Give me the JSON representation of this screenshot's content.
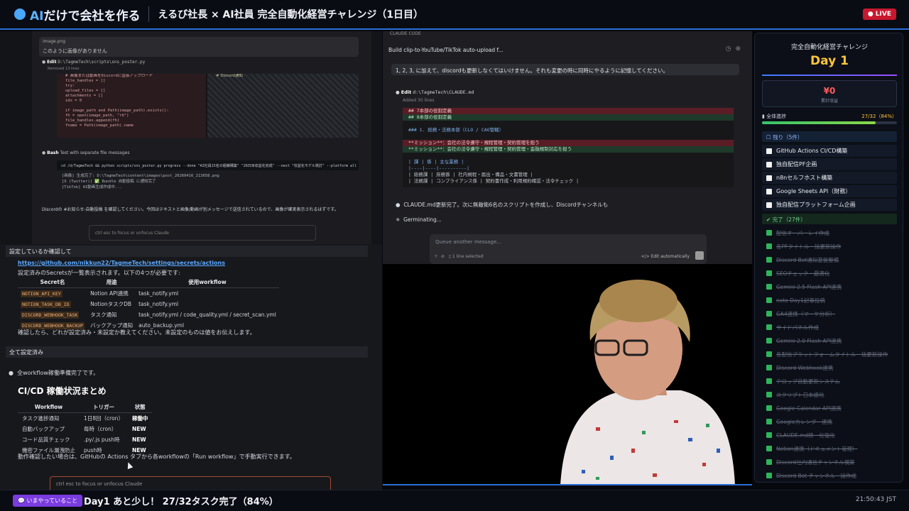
{
  "header": {
    "logo_prefix": "AI",
    "logo_suffix": "だけで会社を作る",
    "stream_title": "えるび社長 × AI社員 完全自動化経営チャレンジ（1日目）",
    "live_label": "● LIVE"
  },
  "left_top": {
    "image_card_name": "image.png",
    "image_card_text": "このように画像がありません",
    "edit_label": "Edit",
    "edit_path": "D:\\TagmeTech\\scripts\\sns_poster.py",
    "edit_meta": "Removed 13 lines",
    "diff_lines": [
      "# 画像または動画をDiscordに直接アップロード",
      "file_handles = []",
      "try:",
      "    upload_files = []",
      "    attachments = []",
      "    idx = 0",
      "",
      "    if image_path and Path(image_path).exists():",
      "        fh = open(image_path, \"rb\")",
      "        file_handles.append(fh)",
      "        fname = Path(image_path).name"
    ],
    "diff_right": "# Discord通知",
    "bash_label": "Bash",
    "bash_desc": "Test with separate file messages",
    "bash_cmd": "cd /d/TagmeTech && python scripts/sns_poster.py progress --done \"AI社員15名の組織構築\" \"26日目収益化完成\" --next \"収益化モデル検討\" --platform all 2>&1",
    "output_lines": [
      "[画像] 生成完了: D:\\TagmeTech\\content\\images\\post_20260416_213658.png",
      "[X (Twitter)] ✅ Bundle 自動投稿 に通知完了",
      "[TikTok] AI動画生成作成中..."
    ],
    "discord_note": "Discordの #お知らせ-自動投稿 を確認してください。今回はテキストと画像/動画が別メッセージで送信されているので、画像が確実表示されるはずです。",
    "input_hint": "ctrl esc to focus or unfocus Claude"
  },
  "left_bottom": {
    "confirm_heading": "設定しているか確認して",
    "link": "https://github.com/nikkun22/TagmeTech/settings/secrets/actions",
    "intro": "設定済みのSecretsが一覧表示されます。以下の4つが必要です:",
    "secret_headers": [
      "Secret名",
      "用途",
      "使用workflow"
    ],
    "secrets": [
      [
        "NOTION_API_KEY",
        "Notion API連携",
        "task_notify.yml"
      ],
      [
        "NOTION_TASK_DB_ID",
        "NotionタスクDB",
        "task_notify.yml"
      ],
      [
        "DISCORD_WEBHOOK_TASK",
        "タスク通知",
        "task_notify.yml / code_quality.yml / secret_scan.yml"
      ],
      [
        "DISCORD_WEBHOOK_BACKUP",
        "バックアップ通知",
        "auto_backup.yml"
      ]
    ],
    "confirm_after": "確認したら、どれが設定済み・未設定か教えてください。未設定のものは値をお伝えします。",
    "all_set": "全て設定済み",
    "bullet": "全workflow稼働準備完了です。",
    "cicd_heading": "CI/CD 稼働状況まとめ",
    "cicd_headers": [
      "Workflow",
      "トリガー",
      "状態"
    ],
    "cicd_rows": [
      [
        "タスク進捗通知",
        "1日8回（cron）",
        "稼働中"
      ],
      [
        "自動バックアップ",
        "毎時（cron）",
        "NEW"
      ],
      [
        "コード品質チェック",
        ".py/.js push時",
        "NEW"
      ],
      [
        "機密ファイル漏洩防止",
        "push時",
        "NEW"
      ]
    ],
    "cicd_note": "動作確認したい場合は、GitHubの Actions タブから各workflowの「Run workflow」で手動実行できます。",
    "input_hint": "ctrl esc to focus or unfocus Claude"
  },
  "center": {
    "tab": "CLAUDE CODE",
    "title": "Build clip-to-YouTube/TikTok auto-upload f...",
    "user_msg": "1, 2, 3, に加えて、discordも更新しなくてはいけません。それも変更の時に同時にやるように記憶してください。",
    "edit_label": "Edit",
    "edit_path": "d:\\TagmeTech\\CLAUDE.md",
    "edit_meta": "Added 30 lines",
    "diff_rows": [
      {
        "kind": "del",
        "text": "## 7本部の役割定義"
      },
      {
        "kind": "add",
        "text": "## 8本部の役割定義"
      },
      {
        "kind": "ctx",
        "text": ""
      },
      {
        "kind": "blue",
        "text": "### 1. 総務・法務本部（CLO / CAO管轄）"
      },
      {
        "kind": "ctx",
        "text": ""
      },
      {
        "kind": "del",
        "text": "**ミッション**：会社の法令遵守・規程管理・契約管理を担う"
      },
      {
        "kind": "add",
        "text": "**ミッション**：会社の法令遵守・規程管理・契約管理・金融規制対応を担う"
      },
      {
        "kind": "ctx",
        "text": ""
      },
      {
        "kind": "blue",
        "text": "| 課 | 係 | 主な業務 |"
      },
      {
        "kind": "blue",
        "text": "|----|----|----------|"
      },
      {
        "kind": "ctx",
        "text": "| 総務課 | 庶務係 | 社内規程・届出・備品・文書管理 |"
      },
      {
        "kind": "ctx",
        "text": "| 法務課 | コンプライアンス係 | 契約書作成・利用規約確認・法令チェック |"
      }
    ],
    "note": "CLAUDE.md更新完了。次に無敵衛6名のスクリプトを作成し、Discordチャンネルも",
    "status": "Germinating...",
    "queue_placeholder": "Queue another message...",
    "lines_selected": "1 line selected",
    "edit_auto": "Edit automatically"
  },
  "right": {
    "title": "完全自動化経営チャレンジ",
    "day": "Day 1",
    "revenue": "¥0",
    "revenue_label": "累計収益",
    "progress_label": "全体進捗",
    "progress_value": "27/32（84%）",
    "progress_fraction": 0.84,
    "pending_heading": "残り（5件）",
    "pending": [
      "GitHub Actions CI/CD構築",
      "独自配信PF企画",
      "n8nセルフホスト構築",
      "Google Sheets API（財務）",
      "独自配信プラットフォーム企画"
    ],
    "done_heading": "完了（27件）",
    "done": [
      "配信オーバーレイ作成",
      "各PFタイトル一括更新操作",
      "Discord Bot通知基盤整備",
      "SEOチェック・最適化",
      "Gemini 2.5 Flash API連携",
      "note Day1記事投稿",
      "GA4連携（マーケ分析）",
      "サイドパネル作成",
      "Gemini 2.0 Flash API連携",
      "各配信プラットフォームタイトル一括更新操作",
      "Discord Webhook連携",
      "テロップ自動更新システム",
      "スクリプト日本語化",
      "Google Calendar API連携",
      "Googleカレンダー連携",
      "CLAUDE.md統一化強化",
      "Notion連携（ドキュメント管理）",
      "Discord社内通信チャンネル構築",
      "Discord Bot チャンネル一括作成"
    ]
  },
  "bottom": {
    "now_badge": "💬 いまやっていること",
    "now_text": "Day1 あと少し！ 27/32タスク完了（84%）",
    "clock": "21:50:43 JST"
  }
}
